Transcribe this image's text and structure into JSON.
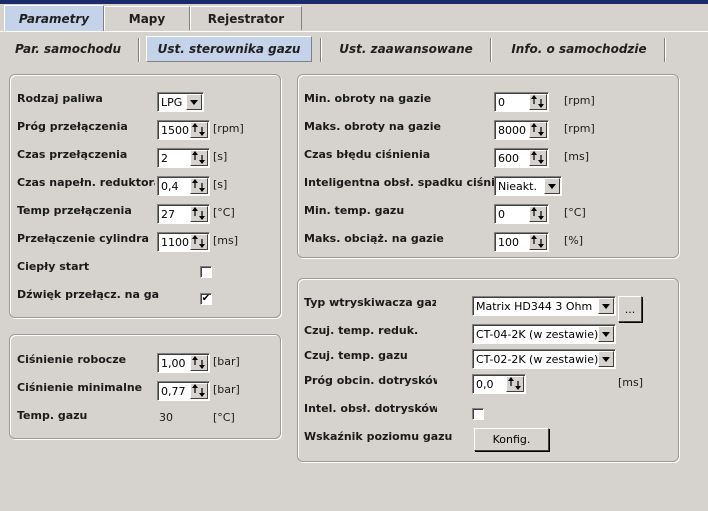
{
  "main_tabs": [
    "Parametry",
    "Mapy",
    "Rejestrator"
  ],
  "sub_tabs": [
    "Par. samochodu",
    "Ust. sterownika gazu",
    "Ust. zaawansowane",
    "Info. o samochodzie"
  ],
  "panel_left_top": {
    "fuel_type_label": "Rodzaj paliwa",
    "fuel_type_value": "LPG",
    "switch_threshold_label": "Próg przełączenia",
    "switch_threshold_value": "1500",
    "switch_threshold_unit": "[rpm]",
    "switch_time_label": "Czas przełączenia",
    "switch_time_value": "2",
    "switch_time_unit": "[s]",
    "reducer_fill_label": "Czas napełn. reduktora",
    "reducer_fill_value": "0,4",
    "reducer_fill_unit": "[s]",
    "switch_temp_label": "Temp przełączenia",
    "switch_temp_value": "27",
    "switch_temp_unit": "[°C]",
    "cylinder_switch_label": "Przełączenie cylindra",
    "cylinder_switch_value": "1100",
    "cylinder_switch_unit": "[ms]",
    "warm_start_label": "Ciepły start",
    "warm_start_checked": false,
    "switch_sound_label": "Dźwięk przełącz. na gaz",
    "switch_sound_checked": true,
    "check_mark": "✔"
  },
  "panel_left_bottom": {
    "working_pressure_label": "Ciśnienie robocze",
    "working_pressure_value": "1,00",
    "working_pressure_unit": "[bar]",
    "min_pressure_label": "Ciśnienie minimalne",
    "min_pressure_value": "0,77",
    "min_pressure_unit": "[bar]",
    "gas_temp_label": "Temp. gazu",
    "gas_temp_value": "30",
    "gas_temp_unit": "[°C]"
  },
  "panel_right_top": {
    "min_rpm_label": "Min. obroty na gazie",
    "min_rpm_value": "0",
    "min_rpm_unit": "[rpm]",
    "max_rpm_label": "Maks. obroty na gazie",
    "max_rpm_value": "8000",
    "max_rpm_unit": "[rpm]",
    "pressure_error_label": "Czas błędu ciśnienia",
    "pressure_error_value": "600",
    "pressure_error_unit": "[ms]",
    "smart_drop_label": "Inteligentna obsł. spadku ciśnienia",
    "smart_drop_value": "Nieakt.",
    "min_gas_temp_label": "Min. temp. gazu",
    "min_gas_temp_value": "0",
    "min_gas_temp_unit": "[°C]",
    "max_load_label": "Maks. obciąż. na gazie",
    "max_load_value": "100",
    "max_load_unit": "[%]"
  },
  "panel_right_bottom": {
    "injector_type_label": "Typ wtryskiwacza gazu",
    "injector_type_value": "Matrix HD344 3 Ohm",
    "ellipsis_label": "...",
    "reducer_sensor_label": "Czuj. temp. reduk.",
    "reducer_sensor_value": "CT-04-2K (w zestawie)",
    "gas_sensor_label": "Czuj. temp. gazu",
    "gas_sensor_value": "CT-02-2K (w zestawie)",
    "extra_inj_threshold_label": "Próg obcin. dotrysków",
    "extra_inj_threshold_value": "0,0",
    "extra_inj_threshold_unit": "[ms]",
    "smart_extra_inj_label": "Intel. obsł. dotrysków",
    "smart_extra_inj_checked": false,
    "gas_level_label": "Wskaźnik poziomu gazu",
    "config_button": "Konfig."
  }
}
